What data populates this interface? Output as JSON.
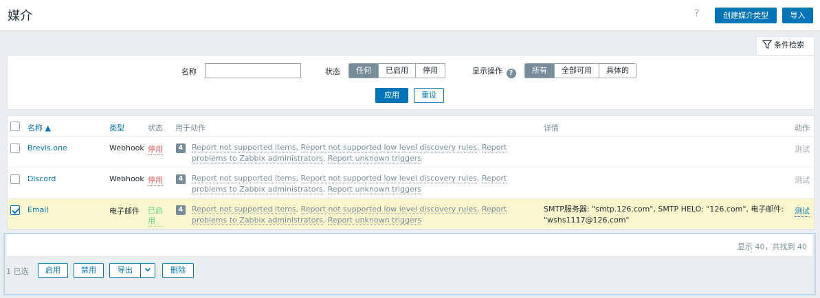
{
  "header": {
    "title": "媒介",
    "help": "?",
    "create_label": "创建媒介类型",
    "import_label": "导入"
  },
  "filter": {
    "tab_label": "条件检索",
    "name_label": "名称",
    "name_value": "",
    "status_label": "状态",
    "status_options": [
      "任何",
      "已启用",
      "停用"
    ],
    "status_selected": "任何",
    "actions_label": "显示操作",
    "actions_help": "?",
    "actions_options": [
      "所有",
      "全部可用",
      "具体的"
    ],
    "actions_selected": "所有",
    "apply_label": "应用",
    "reset_label": "重设"
  },
  "table": {
    "columns": {
      "name": "名称 ▲",
      "type": "类型",
      "status": "状态",
      "used_in": "用于动作",
      "details": "详情",
      "action": "动作"
    },
    "rows": [
      {
        "name": "Brevis.one",
        "type": "Webhook",
        "status": "停用",
        "count": "4",
        "actions": [
          "Report not supported items",
          "Report not supported low level discovery rules",
          "Report problems to Zabbix administrators",
          "Report unknown triggers"
        ],
        "details": "",
        "test": "测试",
        "checked": false
      },
      {
        "name": "Discord",
        "type": "Webhook",
        "status": "停用",
        "count": "4",
        "actions": [
          "Report not supported items",
          "Report not supported low level discovery rules",
          "Report problems to Zabbix administrators",
          "Report unknown triggers"
        ],
        "details": "",
        "test": "测试",
        "checked": false
      },
      {
        "name": "Email",
        "type": "电子邮件",
        "status": "已启用",
        "count": "4",
        "actions": [
          "Report not supported items",
          "Report not supported low level discovery rules",
          "Report problems to Zabbix administrators",
          "Report unknown triggers"
        ],
        "details": "SMTP服务器: \"smtp.126.com\", SMTP HELO: \"126.com\", 电子邮件: \"wshs1117@126.com\"",
        "test": "测试",
        "checked": true
      }
    ]
  },
  "footer": {
    "pager_text": "显示 40，共找到 40",
    "selected_text": "1 已选",
    "enable_label": "启用",
    "disable_label": "禁用",
    "export_label": "导出",
    "delete_label": "删除"
  }
}
